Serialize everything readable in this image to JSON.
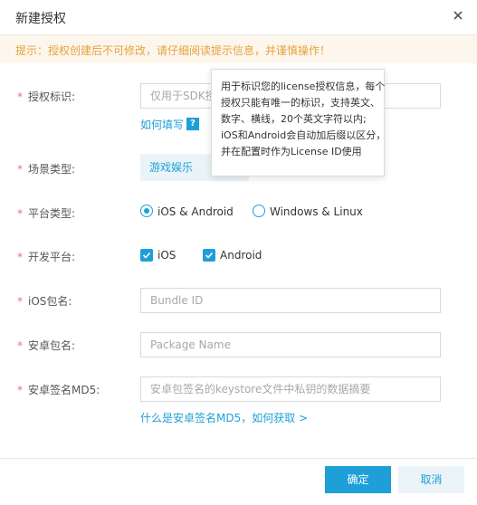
{
  "dialog": {
    "title": "新建授权",
    "notice": "提示：授权创建后不可修改，请仔细阅读提示信息，并谨慎操作！"
  },
  "form": {
    "required_mark": "*",
    "license_id": {
      "label": "授权标识:",
      "placeholder": "仅用于SDK授权",
      "help_link": "如何填写",
      "help_icon": "?"
    },
    "tooltip": {
      "lines": [
        "用于标识您的license授权信息，每个",
        "授权只能有唯一的标识，支持英文、",
        "数字、横线，20个英文字符以内;",
        "iOS和Android会自动加后缀以区分，",
        "并在配置时作为License ID使用"
      ]
    },
    "scene": {
      "label": "场景类型:",
      "value": "游戏娱乐"
    },
    "platform_type": {
      "label": "平台类型:",
      "options": [
        "iOS & Android",
        "Windows & Linux"
      ],
      "selected": "iOS & Android"
    },
    "dev_platform": {
      "label": "开发平台:",
      "options": [
        {
          "label": "iOS",
          "checked": true
        },
        {
          "label": "Android",
          "checked": true
        }
      ]
    },
    "ios_bundle": {
      "label": "iOS包名:",
      "placeholder": "Bundle ID"
    },
    "android_package": {
      "label": "安卓包名:",
      "placeholder": "Package Name"
    },
    "android_md5": {
      "label": "安卓签名MD5:",
      "placeholder": "安卓包签名的keystore文件中私钥的数据摘要",
      "help_link": "什么是安卓签名MD5，如何获取 >"
    }
  },
  "footer": {
    "confirm_label": "确定",
    "cancel_label": "取消"
  },
  "colors": {
    "accent": "#1e9fd8",
    "warning": "#e6a23c",
    "required": "#f56c6c"
  },
  "icons": {
    "close": "close-icon",
    "check": "check-icon"
  }
}
